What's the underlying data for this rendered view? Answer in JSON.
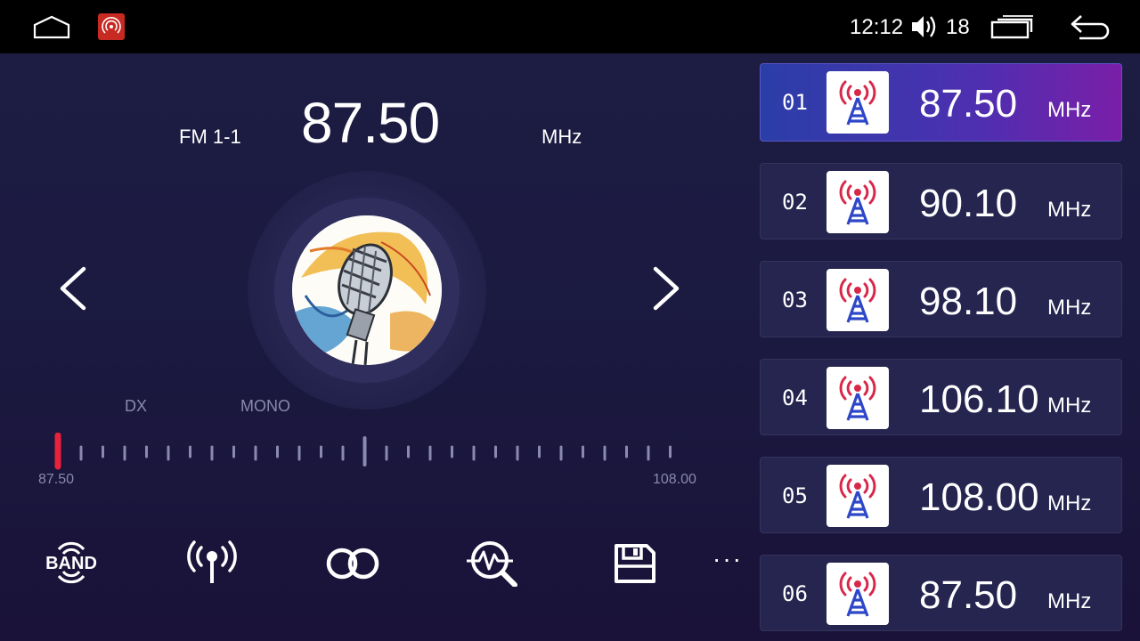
{
  "status_bar": {
    "time": "12:12",
    "volume": "18",
    "icons": [
      "home-icon",
      "radio-app-icon",
      "volume-icon",
      "recent-apps-icon",
      "back-icon"
    ]
  },
  "tuner": {
    "band": "FM 1-1",
    "frequency": "87.50",
    "unit": "MHz",
    "dx_label": "DX",
    "mono_label": "MONO",
    "scale_min": "87.50",
    "scale_max": "108.00",
    "needle_position": 0.0
  },
  "controls": [
    {
      "name": "band-button",
      "label": "BAND"
    },
    {
      "name": "antenna-button",
      "icon": "antenna-icon"
    },
    {
      "name": "stereo-button",
      "icon": "stereo-icon"
    },
    {
      "name": "search-button",
      "icon": "search-scan-icon"
    },
    {
      "name": "save-button",
      "icon": "save-icon"
    },
    {
      "name": "more-button",
      "label": "···"
    }
  ],
  "presets": [
    {
      "num": "01",
      "freq": "87.50",
      "unit": "MHz",
      "active": true
    },
    {
      "num": "02",
      "freq": "90.10",
      "unit": "MHz",
      "active": false
    },
    {
      "num": "03",
      "freq": "98.10",
      "unit": "MHz",
      "active": false
    },
    {
      "num": "04",
      "freq": "106.10",
      "unit": "MHz",
      "active": false
    },
    {
      "num": "05",
      "freq": "108.00",
      "unit": "MHz",
      "active": false
    },
    {
      "num": "06",
      "freq": "87.50",
      "unit": "MHz",
      "active": false
    }
  ],
  "colors": {
    "background": "#1c1b42",
    "needle": "#e8223a",
    "active_preset_start": "#2a3ea8",
    "active_preset_end": "#7a1ea8",
    "tower_red": "#d8284a",
    "tower_blue": "#2e47c8"
  }
}
